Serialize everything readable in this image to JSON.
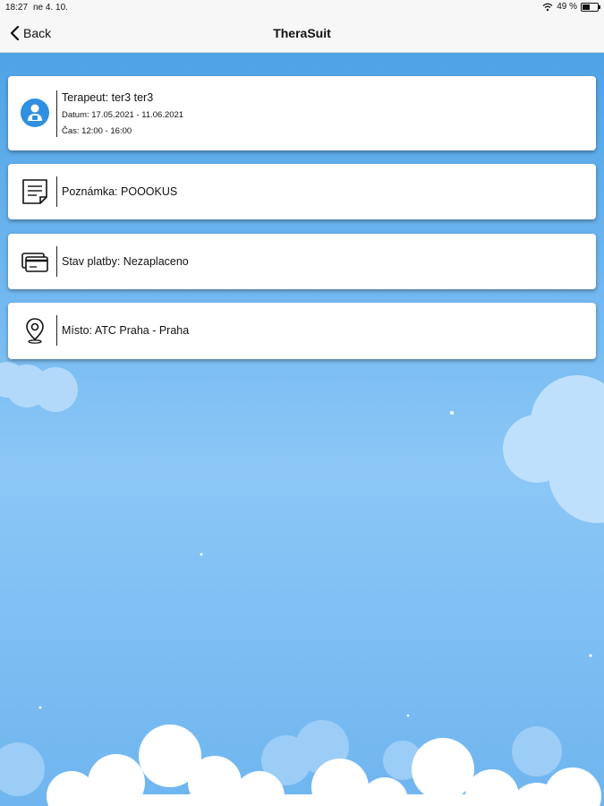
{
  "status": {
    "time": "18:27",
    "date": "ne 4. 10.",
    "battery": "49 %"
  },
  "nav": {
    "back_label": "Back",
    "title": "TheraSuit"
  },
  "cards": [
    {
      "icon": "therapist-icon",
      "title": "Terapeut: ter3 ter3",
      "line2": "Datum: 17.05.2021 - 11.06.2021",
      "line3": "Čas: 12:00 - 16:00"
    },
    {
      "icon": "note-icon",
      "text": "Poznámka: POOOKUS"
    },
    {
      "icon": "credit-card-icon",
      "text": "Stav platby: Nezaplaceno"
    },
    {
      "icon": "location-pin-icon",
      "text": "Místo: ATC Praha - Praha"
    }
  ],
  "colors": {
    "sky_top": "#4ea3e6",
    "sky_mid": "#8cc7f7",
    "icon_blue": "#2f8fe0"
  }
}
